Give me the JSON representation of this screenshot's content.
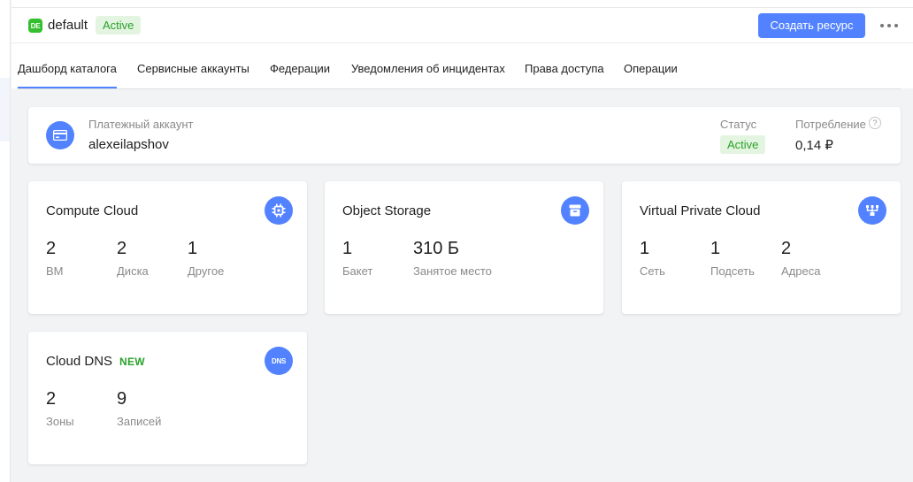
{
  "header": {
    "folder_badge": "DE",
    "folder_name": "default",
    "status": "Active",
    "create_button": "Создать ресурс",
    "more_icon": "more-horizontal-icon"
  },
  "tabs": [
    {
      "label": "Дашборд каталога",
      "active": true
    },
    {
      "label": "Сервисные аккаунты",
      "active": false
    },
    {
      "label": "Федерации",
      "active": false
    },
    {
      "label": "Уведомления об инцидентах",
      "active": false
    },
    {
      "label": "Права доступа",
      "active": false
    },
    {
      "label": "Операции",
      "active": false
    }
  ],
  "billing": {
    "icon": "credit-card-icon",
    "caption": "Платежный аккаунт",
    "name": "alexeilapshov",
    "status_caption": "Статус",
    "status": "Active",
    "usage_caption": "Потребление",
    "usage_help": "?",
    "usage_value": "0,14 ₽"
  },
  "services": [
    {
      "title": "Compute Cloud",
      "icon": "compute-chip-icon",
      "metrics": [
        {
          "value": "2",
          "label": "ВМ"
        },
        {
          "value": "2",
          "label": "Диска"
        },
        {
          "value": "1",
          "label": "Другое"
        }
      ]
    },
    {
      "title": "Object Storage",
      "icon": "storage-box-icon",
      "metrics": [
        {
          "value": "1",
          "label": "Бакет"
        },
        {
          "value": "310 Б",
          "label": "Занятое место"
        }
      ]
    },
    {
      "title": "Virtual Private Cloud",
      "icon": "network-icon",
      "metrics": [
        {
          "value": "1",
          "label": "Сеть"
        },
        {
          "value": "1",
          "label": "Подсеть"
        },
        {
          "value": "2",
          "label": "Адреса"
        }
      ]
    },
    {
      "title": "Cloud DNS",
      "badge": "NEW",
      "icon": "dns-icon",
      "icon_text": "DNS",
      "metrics": [
        {
          "value": "2",
          "label": "Зоны"
        },
        {
          "value": "9",
          "label": "Записей"
        }
      ]
    }
  ],
  "colors": {
    "accent": "#5282ff",
    "success": "#2ba12a",
    "success_bg": "#e3f5e1",
    "folder_badge": "#34c02e"
  }
}
